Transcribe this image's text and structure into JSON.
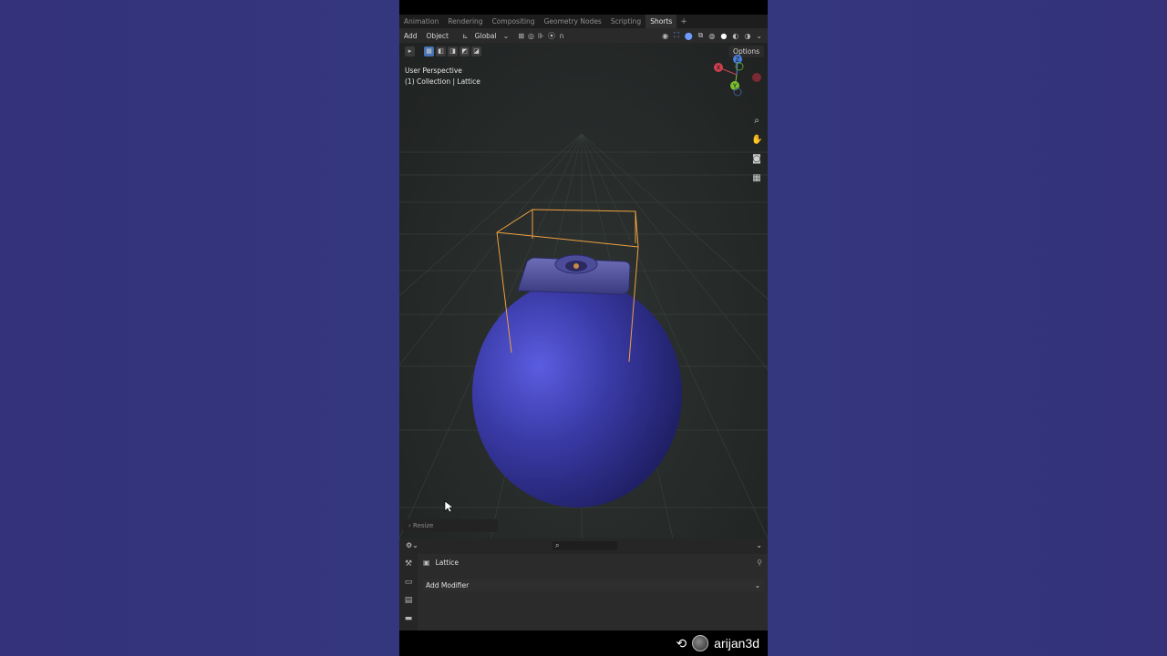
{
  "tabs": [
    {
      "label": "Animation",
      "active": false
    },
    {
      "label": "Rendering",
      "active": false
    },
    {
      "label": "Compositing",
      "active": false
    },
    {
      "label": "Geometry Nodes",
      "active": false
    },
    {
      "label": "Scripting",
      "active": false
    },
    {
      "label": "Shorts",
      "active": true
    }
  ],
  "tab_add": "+",
  "header": {
    "add": "Add",
    "object": "Object",
    "orientation": "Global"
  },
  "viewport": {
    "options": "Options",
    "view_name": "User Perspective",
    "collection_info": "(1) Collection | Lattice",
    "gizmo": {
      "z": "Z",
      "y": "Y",
      "x": "X"
    },
    "last_op": "Resize"
  },
  "properties": {
    "object_name": "Lattice",
    "add_modifier": "Add Modifier"
  },
  "credit": {
    "username": "arijan3d"
  },
  "colors": {
    "sphere": "#3a3aa6",
    "lattice": "#f0a040",
    "background": "#33327a"
  }
}
